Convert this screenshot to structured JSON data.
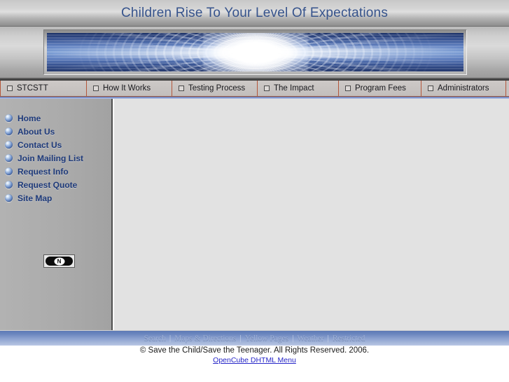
{
  "header": {
    "site_title": "Children Rise To Your Level Of Expectations"
  },
  "banner": {
    "alt_name": "blue-light-burst-banner"
  },
  "topnav": {
    "items": [
      {
        "label": "STCSTT",
        "width": 124
      },
      {
        "label": "How It Works",
        "width": 123
      },
      {
        "label": "Testing Process",
        "width": 123
      },
      {
        "label": "The Impact",
        "width": 117
      },
      {
        "label": "Program Fees",
        "width": 119
      },
      {
        "label": "Administrators",
        "width": 122
      }
    ]
  },
  "sidebar": {
    "items": [
      {
        "label": "Home"
      },
      {
        "label": "About Us"
      },
      {
        "label": "Contact Us"
      },
      {
        "label": "Join Mailing List"
      },
      {
        "label": "Request Info"
      },
      {
        "label": "Request Quote"
      },
      {
        "label": "Site Map"
      }
    ],
    "badge": {
      "letter": "N",
      "name": "netobjects-fusion-badge"
    }
  },
  "content": {
    "body_text": ""
  },
  "footer": {
    "links": [
      {
        "label": "Search"
      },
      {
        "label": "Maps & Directions"
      },
      {
        "label": "Yellow Pages"
      },
      {
        "label": "Weather"
      },
      {
        "label": "Restricted"
      }
    ],
    "separator": "|",
    "copyright": "© Save the Child/Save the Teenager. All Rights Reserved. 2006.",
    "builder_link": "OpenCube DHTML Menu"
  },
  "colors": {
    "title_text": "#36538c",
    "sidebar_link": "#1e3a7a",
    "nav_border": "#b4563a",
    "footer_bar_top": "#5c79b5",
    "footer_bar_bottom": "#b9c7e4",
    "link": "#2626c8"
  }
}
